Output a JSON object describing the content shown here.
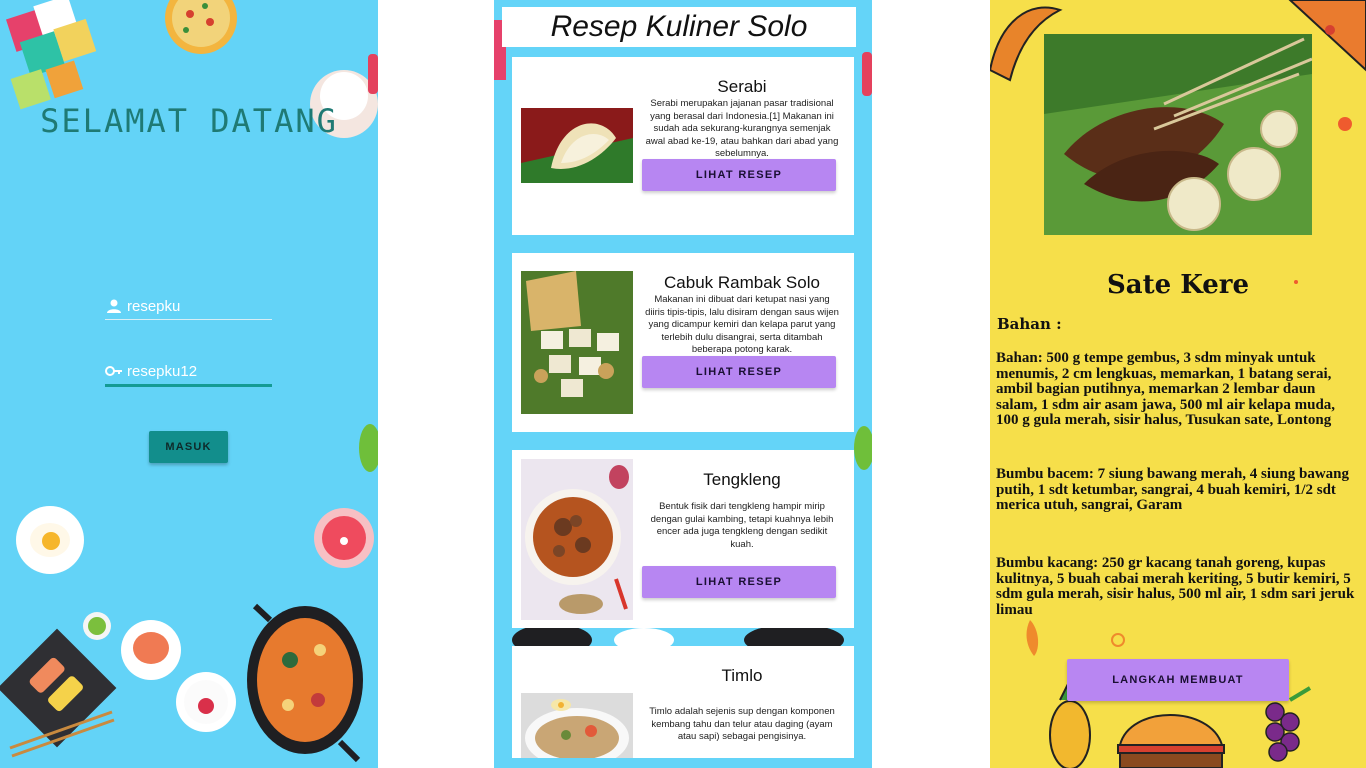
{
  "login": {
    "title": "SELAMAT DATANG",
    "username": {
      "value": "resepku"
    },
    "password": {
      "value": "resepku12"
    },
    "submit_label": "MASUK"
  },
  "list": {
    "header": "Resep Kuliner Solo",
    "button_label": "LIHAT RESEP",
    "items": [
      {
        "title": "Serabi",
        "description": "Serabi merupakan jajanan pasar tradisional yang berasal dari Indonesia.[1] Makanan ini sudah ada sekurang-kurangnya semenjak awal abad ke-19, atau bahkan dari abad yang sebelumnya."
      },
      {
        "title": "Cabuk Rambak Solo",
        "description": "Makanan ini dibuat dari ketupat nasi yang diiris tipis-tipis, lalu disiram dengan saus wijen yang dicampur kemiri dan kelapa parut yang terlebih dulu disangrai, serta ditambah beberapa potong karak."
      },
      {
        "title": "Tengkleng",
        "description": "Bentuk fisik dari tengkleng hampir mirip dengan gulai kambing, tetapi kuahnya lebih encer ada juga tengkleng dengan sedikit kuah."
      },
      {
        "title": "Timlo",
        "description": "Timlo adalah sejenis sup dengan komponen kembang tahu dan telur atau daging (ayam atau sapi) sebagai pengisinya."
      }
    ]
  },
  "detail": {
    "title": "Sate Kere",
    "section_label": "Bahan :",
    "bahan": "Bahan: 500 g tempe gembus, 3 sdm minyak untuk menumis, 2 cm lengkuas, memarkan, 1 batang serai, ambil bagian putihnya, memarkan 2 lembar daun salam, 1 sdm air asam jawa, 500 ml air kelapa muda, 100 g gula merah, sisir halus, Tusukan sate, Lontong",
    "bumbu_bacem": "Bumbu bacem: 7 siung bawang merah, 4 siung bawang putih, 1 sdt ketumbar, sangrai, 4 buah kemiri, 1/2 sdt merica utuh, sangrai, Garam",
    "bumbu_kacang": "Bumbu kacang: 250 gr kacang tanah goreng, kupas kulitnya, 5 buah cabai merah keriting, 5 butir kemiri, 5 sdm gula merah, sisir halus, 500 ml air, 1 sdm sari jeruk limau",
    "button_label": "LANGKAH MEMBUAT"
  },
  "colors": {
    "login_bg": "#63d3f7",
    "login_button": "#128e8c",
    "list_bg": "#64d4f8",
    "accent_button": "#b786f2",
    "detail_bg": "#f6df4a"
  },
  "icons": {
    "username": "person-icon",
    "password": "key-icon"
  }
}
